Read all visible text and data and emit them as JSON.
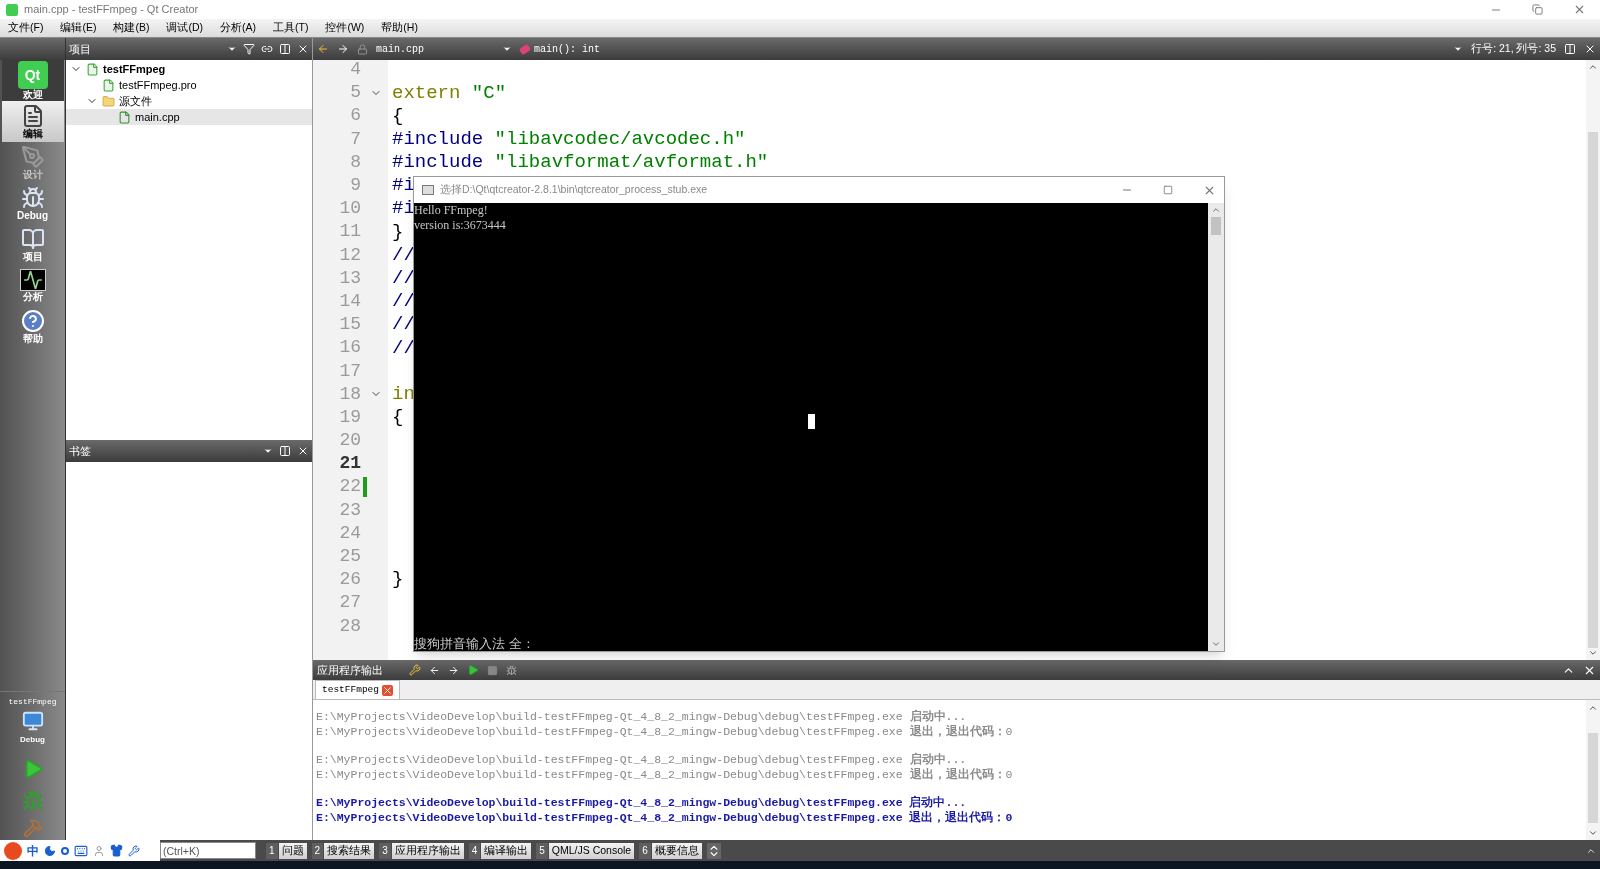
{
  "window": {
    "title": "main.cpp - testFFmpeg - Qt Creator"
  },
  "menu": [
    "文件(F)",
    "编辑(E)",
    "构建(B)",
    "调试(D)",
    "分析(A)",
    "工具(T)",
    "控件(W)",
    "帮助(H)"
  ],
  "mode_bar": {
    "modes": [
      {
        "label": "欢迎",
        "kind": "welcome",
        "logo": "Qt",
        "selected": false,
        "disabled": false
      },
      {
        "label": "编辑",
        "kind": "edit",
        "selected": true,
        "disabled": false
      },
      {
        "label": "设计",
        "kind": "design",
        "selected": false,
        "disabled": true
      },
      {
        "label": "Debug",
        "kind": "debug",
        "selected": false,
        "disabled": false
      },
      {
        "label": "项目",
        "kind": "projects",
        "selected": false,
        "disabled": false
      },
      {
        "label": "分析",
        "kind": "analyze",
        "selected": false,
        "disabled": false
      },
      {
        "label": "帮助",
        "kind": "help",
        "selected": false,
        "disabled": false
      }
    ],
    "target": {
      "project": "testFFmpeg",
      "config": "Debug"
    }
  },
  "project_pane": {
    "title": "项目",
    "tree": [
      {
        "label": "testFFmpeg",
        "kind": "project",
        "expanded": true,
        "selected": false,
        "children": [
          {
            "label": "testFFmpeg.pro",
            "kind": "pro",
            "selected": false
          },
          {
            "label": "源文件",
            "kind": "folder",
            "expanded": true,
            "selected": false,
            "children": [
              {
                "label": "main.cpp",
                "kind": "cpp",
                "selected": true
              }
            ]
          }
        ]
      }
    ]
  },
  "bookmarks_pane": {
    "title": "书签"
  },
  "editor": {
    "file": "main.cpp",
    "symbol": "main(): int",
    "position": "行号: 21, 列号: 35",
    "lines": [
      {
        "number": "4",
        "current": false,
        "fold": false
      },
      {
        "number": "5",
        "current": false,
        "fold": true,
        "tokens": [
          {
            "kind": "keyword",
            "text": "extern"
          },
          {
            "kind": "string",
            "text": " \"C\""
          }
        ]
      },
      {
        "number": "6",
        "current": false,
        "fold": false,
        "tokens": [
          {
            "kind": "plain",
            "text": "{"
          }
        ]
      },
      {
        "number": "7",
        "current": false,
        "fold": false,
        "tokens": [
          {
            "kind": "preprocessor",
            "text": "#include"
          },
          {
            "kind": "string",
            "text": " \"libavcodec/avcodec.h\""
          }
        ]
      },
      {
        "number": "8",
        "current": false,
        "fold": false,
        "tokens": [
          {
            "kind": "preprocessor",
            "text": "#include"
          },
          {
            "kind": "string",
            "text": " \"libavformat/avformat.h\""
          }
        ]
      },
      {
        "number": "9",
        "current": false,
        "fold": false,
        "tokens": [
          {
            "kind": "preprocessor",
            "text": "#i"
          }
        ]
      },
      {
        "number": "10",
        "current": false,
        "fold": false,
        "tokens": [
          {
            "kind": "preprocessor",
            "text": "#i"
          }
        ]
      },
      {
        "number": "11",
        "current": false,
        "fold": false,
        "tokens": [
          {
            "kind": "plain",
            "text": "}"
          }
        ]
      },
      {
        "number": "12",
        "current": false,
        "fold": false,
        "tokens": [
          {
            "kind": "comment",
            "text": "//"
          }
        ]
      },
      {
        "number": "13",
        "current": false,
        "fold": false,
        "tokens": [
          {
            "kind": "comment",
            "text": "//"
          }
        ]
      },
      {
        "number": "14",
        "current": false,
        "fold": false,
        "tokens": [
          {
            "kind": "comment",
            "text": "//"
          }
        ]
      },
      {
        "number": "15",
        "current": false,
        "fold": false,
        "tokens": [
          {
            "kind": "comment",
            "text": "//"
          }
        ]
      },
      {
        "number": "16",
        "current": false,
        "fold": false,
        "tokens": [
          {
            "kind": "comment",
            "text": "//"
          }
        ]
      },
      {
        "number": "17",
        "current": false,
        "fold": false
      },
      {
        "number": "18",
        "current": false,
        "fold": true,
        "tokens": [
          {
            "kind": "keyword",
            "text": "in"
          }
        ]
      },
      {
        "number": "19",
        "current": false,
        "fold": false,
        "tokens": [
          {
            "kind": "plain",
            "text": "{"
          }
        ]
      },
      {
        "number": "20",
        "current": false,
        "fold": false
      },
      {
        "number": "21",
        "current": true,
        "fold": false
      },
      {
        "number": "22",
        "current": false,
        "fold": false
      },
      {
        "number": "23",
        "current": false,
        "fold": false
      },
      {
        "number": "24",
        "current": false,
        "fold": false
      },
      {
        "number": "25",
        "current": false,
        "fold": false
      },
      {
        "number": "26",
        "current": false,
        "fold": false,
        "tokens": [
          {
            "kind": "plain",
            "text": "}"
          }
        ]
      },
      {
        "number": "27",
        "current": false,
        "fold": false
      },
      {
        "number": "28",
        "current": false,
        "fold": false
      }
    ]
  },
  "console": {
    "title": "选择D:\\Qt\\qtcreator-2.8.1\\bin\\qtcreator_process_stub.exe",
    "lines": [
      "Hello FFmpeg!",
      "version is:3673444"
    ],
    "ime_status": "搜狗拼音输入法 全 :"
  },
  "output_pane": {
    "title": "应用程序输出",
    "tabs": [
      {
        "label": "testFFmpeg",
        "selected": true
      }
    ],
    "runs": [
      {
        "current": false,
        "lines": [
          "E:\\MyProjects\\VideoDevelop\\build-testFFmpeg-Qt_4_8_2_mingw-Debug\\debug\\testFFmpeg.exe **启动中...**",
          "E:\\MyProjects\\VideoDevelop\\build-testFFmpeg-Qt_4_8_2_mingw-Debug\\debug\\testFFmpeg.exe **退出，退出代码：**0"
        ]
      },
      {
        "current": false,
        "lines": [
          "E:\\MyProjects\\VideoDevelop\\build-testFFmpeg-Qt_4_8_2_mingw-Debug\\debug\\testFFmpeg.exe **启动中...**",
          "E:\\MyProjects\\VideoDevelop\\build-testFFmpeg-Qt_4_8_2_mingw-Debug\\debug\\testFFmpeg.exe **退出，退出代码：**0"
        ]
      },
      {
        "current": true,
        "lines": [
          "E:\\MyProjects\\VideoDevelop\\build-testFFmpeg-Qt_4_8_2_mingw-Debug\\debug\\testFFmpeg.exe 启动中...",
          "E:\\MyProjects\\VideoDevelop\\build-testFFmpeg-Qt_4_8_2_mingw-Debug\\debug\\testFFmpeg.exe 退出，退出代码：0"
        ]
      }
    ]
  },
  "ime_bar": {
    "mode": "中"
  },
  "status_bar": {
    "locator": {
      "placeholder": "(Ctrl+K)"
    },
    "panes": [
      {
        "number": "1",
        "label": "问题"
      },
      {
        "number": "2",
        "label": "搜索结果"
      },
      {
        "number": "3",
        "label": "应用程序输出"
      },
      {
        "number": "4",
        "label": "编译输出"
      },
      {
        "number": "5",
        "label": "QML/JS Console"
      },
      {
        "number": "6",
        "label": "概要信息"
      }
    ]
  }
}
